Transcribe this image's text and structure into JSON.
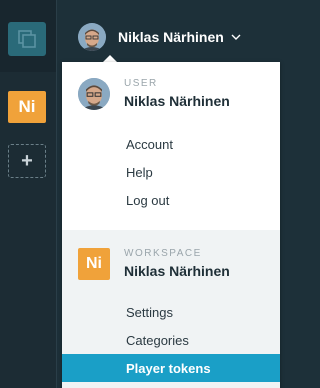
{
  "colors": {
    "background": "#1d3039",
    "rail": "#1c2c34",
    "app_button": "#2a6a79",
    "workspace_badge": "#f0a23a",
    "active_item": "#1a9fc7",
    "workspace_section_bg": "#f0f3f4"
  },
  "sidebar": {
    "app_icon": "copy-icon",
    "workspace_badge": "Ni",
    "add_workspace_icon": "plus-icon",
    "add_workspace_label": "+"
  },
  "header": {
    "user_name": "Niklas Närhinen",
    "dropdown_icon": "chevron-down-icon"
  },
  "dropdown": {
    "user": {
      "kicker": "User",
      "name": "Niklas Närhinen",
      "items": [
        {
          "label": "Account"
        },
        {
          "label": "Help"
        },
        {
          "label": "Log out"
        }
      ]
    },
    "workspace": {
      "badge": "Ni",
      "kicker": "Workspace",
      "name": "Niklas Närhinen",
      "items": [
        {
          "label": "Settings"
        },
        {
          "label": "Categories"
        },
        {
          "label": "Player tokens",
          "active": true
        }
      ]
    }
  }
}
